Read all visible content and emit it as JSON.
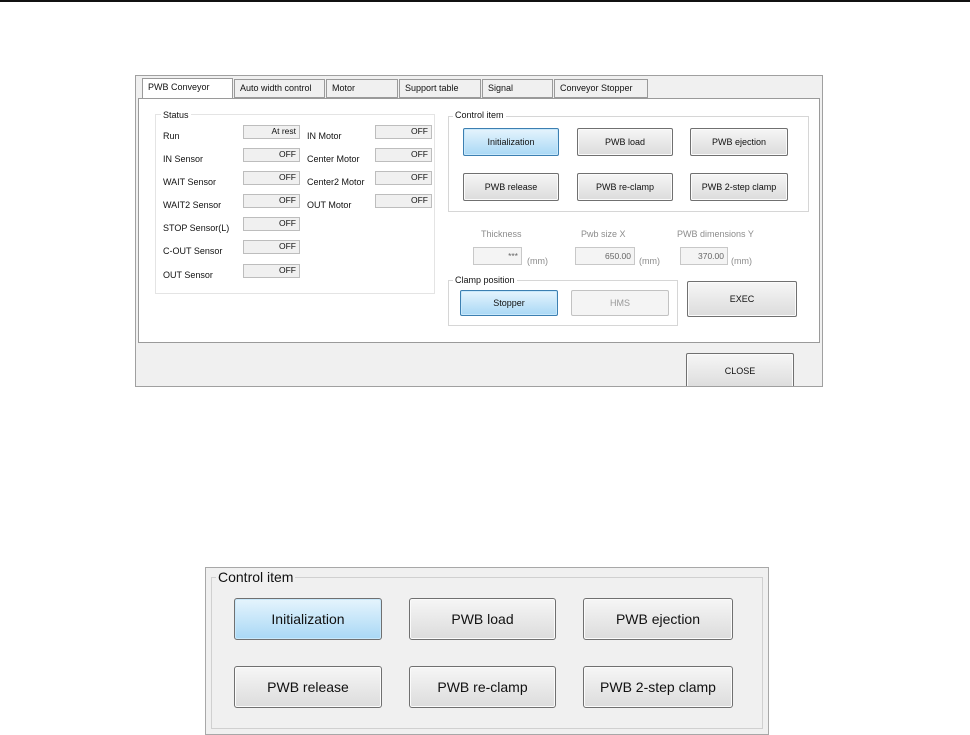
{
  "tabs": [
    {
      "label": "PWB Conveyor",
      "active": true
    },
    {
      "label": "Auto width control",
      "active": false
    },
    {
      "label": "Motor",
      "active": false
    },
    {
      "label": "Support table",
      "active": false
    },
    {
      "label": "Signal",
      "active": false
    },
    {
      "label": "Conveyor Stopper",
      "active": false
    }
  ],
  "status": {
    "title": "Status",
    "left": [
      {
        "label": "Run",
        "value": "At rest"
      },
      {
        "label": "IN Sensor",
        "value": "OFF"
      },
      {
        "label": "WAIT Sensor",
        "value": "OFF"
      },
      {
        "label": "WAIT2 Sensor",
        "value": "OFF"
      },
      {
        "label": "STOP Sensor(L)",
        "value": "OFF"
      },
      {
        "label": "C-OUT Sensor",
        "value": "OFF"
      },
      {
        "label": "OUT Sensor",
        "value": "OFF"
      }
    ],
    "right": [
      {
        "label": "IN Motor",
        "value": "OFF"
      },
      {
        "label": "Center Motor",
        "value": "OFF"
      },
      {
        "label": "Center2 Motor",
        "value": "OFF"
      },
      {
        "label": "OUT Motor",
        "value": "OFF"
      }
    ]
  },
  "control": {
    "title": "Control item",
    "buttons": [
      {
        "label": "Initialization",
        "selected": true
      },
      {
        "label": "PWB load",
        "selected": false
      },
      {
        "label": "PWB ejection",
        "selected": false
      },
      {
        "label": "PWB release",
        "selected": false
      },
      {
        "label": "PWB re-clamp",
        "selected": false
      },
      {
        "label": "PWB 2-step clamp",
        "selected": false
      }
    ]
  },
  "params": {
    "thickness": {
      "label": "Thickness",
      "value": "***",
      "unit": "(mm)"
    },
    "size_x": {
      "label": "Pwb size X",
      "value": "650.00",
      "unit": "(mm)"
    },
    "size_y": {
      "label": "PWB dimensions Y",
      "value": "370.00",
      "unit": "(mm)"
    }
  },
  "clamp": {
    "title": "Clamp position",
    "stopper": "Stopper",
    "hms": "HMS"
  },
  "exec_label": "EXEC",
  "close_label": "CLOSE"
}
